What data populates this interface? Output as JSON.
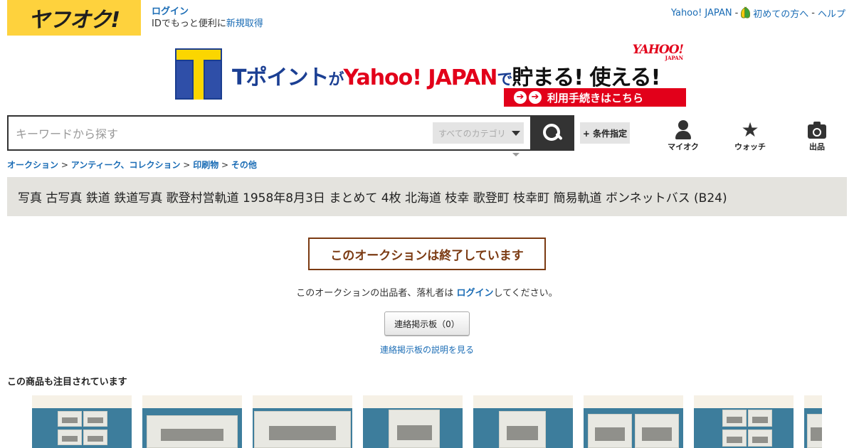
{
  "header": {
    "logo_text": "ヤフオク!",
    "login_label": "ログイン",
    "login_sub_prefix": "IDでもっと便利に",
    "signup_label": "新規取得",
    "top_links": {
      "yahoo_japan": "Yahoo! JAPAN",
      "separator": "-",
      "beginners": "初めての方へ",
      "help": "ヘルプ"
    }
  },
  "banner": {
    "tpoint": "Tポイント",
    "ga": "が",
    "yahoo": "Yahoo! JAPAN",
    "de": "で",
    "tamaru": "貯まる! 使える!",
    "yahoo_logo": "YAHOO!",
    "yahoo_logo_sub": "JAPAN",
    "cta_label": "利用手続きはこちら",
    "cta_arrow": "➔"
  },
  "search": {
    "placeholder": "キーワードから探す",
    "category_label": "すべてのカテゴリ",
    "conditions_label": "+ 条件指定"
  },
  "nav": {
    "my_auction": "マイオク",
    "watch": "ウォッチ",
    "sell": "出品"
  },
  "breadcrumb": {
    "items": [
      "オークション",
      "アンティーク、コレクション",
      "印刷物",
      "その他"
    ],
    "separator": ">"
  },
  "item": {
    "title": "写真 古写真 鉄道 鉄道写真 歌登村営軌道 1958年8月3日 まとめて 4枚 北海道 枝幸 歌登町 枝幸町 簡易軌道 ボンネットバス (B24)"
  },
  "ended": {
    "message": "このオークションは終了しています",
    "note_prefix": "このオークションの出品者、落札者は ",
    "note_link": "ログイン",
    "note_suffix": "してください。",
    "board_button": "連絡掲示板（0）",
    "board_help": "連絡掲示板の説明を見る"
  },
  "related": {
    "heading": "この商品も注目されています",
    "count": 8
  },
  "colors": {
    "logo_yellow": "#fed23d",
    "link_blue": "#1a6cb5",
    "ended_brown": "#7b3a12",
    "title_bg": "#e4e3de",
    "banner_red": "#e2001a"
  }
}
